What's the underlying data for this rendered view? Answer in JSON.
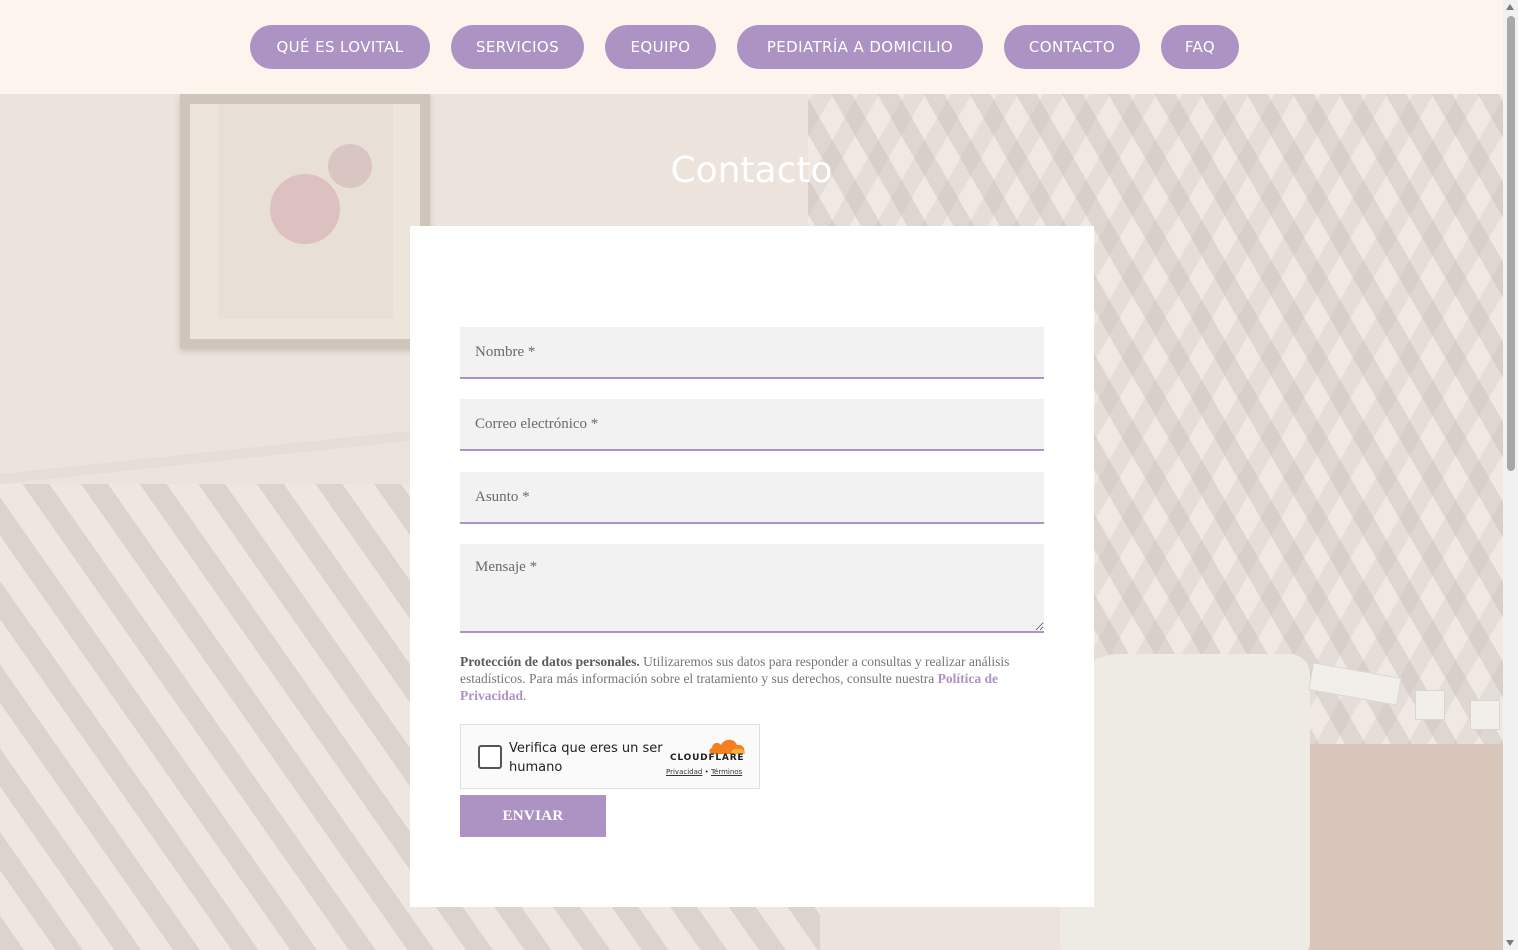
{
  "nav": {
    "items": [
      {
        "label": "QUÉ ES LOVITAL"
      },
      {
        "label": "SERVICIOS"
      },
      {
        "label": "EQUIPO"
      },
      {
        "label": "PEDIATRÍA A DOMICILIO"
      },
      {
        "label": "CONTACTO"
      },
      {
        "label": "FAQ"
      }
    ]
  },
  "page": {
    "title": "Contacto"
  },
  "form": {
    "name_placeholder": "Nombre *",
    "email_placeholder": "Correo electrónico *",
    "subject_placeholder": "Asunto *",
    "message_placeholder": "Mensaje *",
    "privacy_bold": "Protección de datos personales.",
    "privacy_text": " Utilizaremos sus datos para responder a consultas y realizar análisis estadísticos. Para más información sobre el tratamiento y sus derechos, consulte nuestra ",
    "privacy_link": "Política de Privacidad",
    "privacy_end": ".",
    "submit_label": "ENVIAR"
  },
  "captcha": {
    "label": "Verifica que eres un ser humano",
    "brand": "CLOUDFLARE",
    "privacy_link": "Privacidad",
    "separator": "•",
    "terms_link": "Términos"
  },
  "colors": {
    "accent": "#ad92c4",
    "nav_bg": "#fdf4ee"
  }
}
